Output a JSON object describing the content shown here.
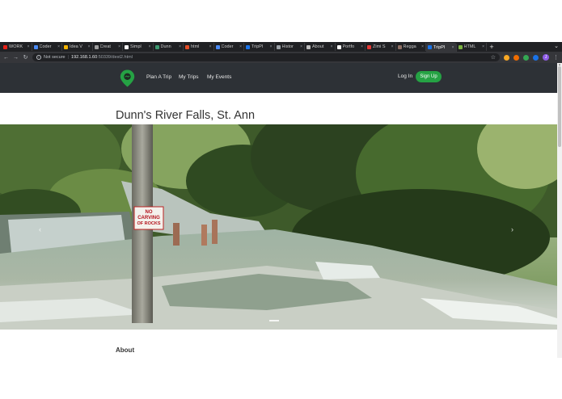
{
  "browser": {
    "tabs": [
      {
        "label": "WORK",
        "color": "#e62117"
      },
      {
        "label": "Coder",
        "color": "#4a8af4"
      },
      {
        "label": "Idea V",
        "color": "#f4b400"
      },
      {
        "label": "Creat",
        "color": "#9e9e9e"
      },
      {
        "label": "Simpl",
        "color": "#ffffff"
      },
      {
        "label": "Dunn",
        "color": "#3d9970"
      },
      {
        "label": "html",
        "color": "#e44d26"
      },
      {
        "label": "Coder",
        "color": "#4a8af4"
      },
      {
        "label": "TripPl",
        "color": "#1a73e8"
      },
      {
        "label": "Histor",
        "color": "#9aa0a6"
      },
      {
        "label": "About",
        "color": "#bdbdbd"
      },
      {
        "label": "Portfo",
        "color": "#ffffff"
      },
      {
        "label": "Zimi S",
        "color": "#e53935"
      },
      {
        "label": "Regga",
        "color": "#8d6e63"
      },
      {
        "label": "TripPl",
        "color": "#1a73e8",
        "active": true
      },
      {
        "label": "HTML",
        "color": "#7cb342"
      }
    ],
    "new_tab": "+",
    "url": {
      "security": "Not secure",
      "host": "192.168.1.60",
      "path": ":50339/dest2.html"
    },
    "avatar_letter": "J"
  },
  "site": {
    "logo_icon": "map-pin-icon",
    "nav": {
      "plan": "Plan A Trip",
      "trips": "My Trips",
      "events": "My Events"
    },
    "login": "Log In",
    "signup": "Sign Up",
    "accent": "#25a244",
    "navbar_color": "#2d3136"
  },
  "page": {
    "title": "Dunn's River Falls, St. Ann",
    "about_heading": "About"
  },
  "carousel": {
    "prev": "‹",
    "next": "›",
    "sign_lines": [
      "NO",
      "CARVING",
      "OF ROCKS"
    ]
  }
}
